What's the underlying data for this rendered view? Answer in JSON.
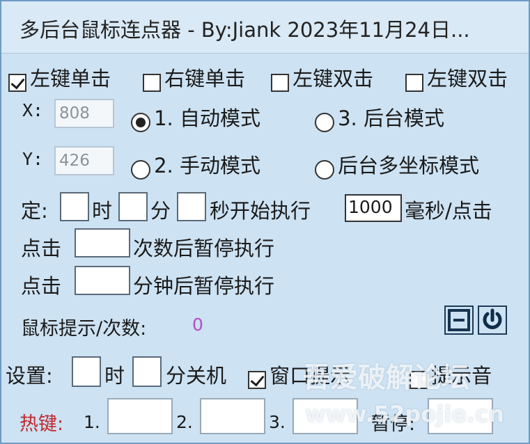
{
  "window": {
    "title": "多后台鼠标连点器 - By:Jiank 2023年11月24日..."
  },
  "click_types": [
    {
      "label": "左键单击",
      "checked": true
    },
    {
      "label": "右键单击",
      "checked": false
    },
    {
      "label": "左键双击",
      "checked": false
    },
    {
      "label": "左键双击",
      "checked": false
    }
  ],
  "coords": {
    "x_label": "X:",
    "x_value": "808",
    "y_label": "Y:",
    "y_value": "426"
  },
  "modes": [
    {
      "label": "1. 自动模式",
      "selected": true
    },
    {
      "label": "3. 后台模式",
      "selected": false
    },
    {
      "label": "2. 手动模式",
      "selected": false
    },
    {
      "label": "后台多坐标模式",
      "selected": false
    }
  ],
  "timer": {
    "prefix": "定:",
    "hour": "时",
    "minute": "分",
    "second_suffix": "秒开始执行",
    "interval_value": "1000",
    "interval_unit": "毫秒/点击"
  },
  "pause_count": {
    "prefix": "点击",
    "suffix": "次数后暂停执行"
  },
  "pause_minutes": {
    "prefix": "点击",
    "suffix": "分钟后暂停执行"
  },
  "status": {
    "label": "鼠标提示/次数:",
    "count": "0",
    "count_color": "#b04fc8"
  },
  "settings": {
    "prefix": "设置:",
    "hour": "时",
    "minute_suffix": "分关机",
    "popup_label": "窗口提示",
    "popup_checked": true,
    "sound_label": "提示音"
  },
  "hotkeys": {
    "label": "热键:",
    "k1": "1.",
    "k2": "2.",
    "k3": "3.",
    "pause": "暂停:"
  },
  "watermark": {
    "line1": "吾爱破解论坛",
    "line2": "www.52pojie.cn"
  }
}
